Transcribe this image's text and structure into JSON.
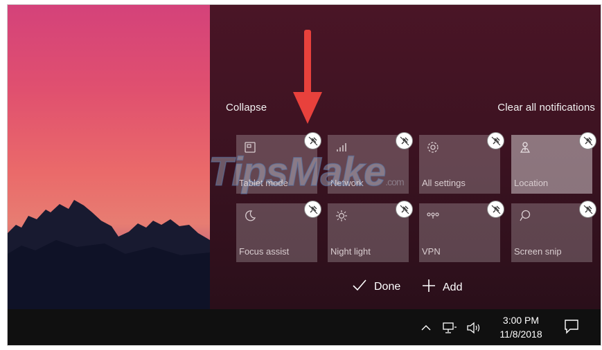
{
  "action_center": {
    "collapse_label": "Collapse",
    "clear_all_label": "Clear all notifications",
    "tiles": [
      {
        "label": "Tablet mode",
        "icon": "tablet-mode-icon",
        "selected": false
      },
      {
        "label": "Network",
        "icon": "network-icon",
        "selected": false
      },
      {
        "label": "All settings",
        "icon": "settings-gear-icon",
        "selected": false
      },
      {
        "label": "Location",
        "icon": "location-icon",
        "selected": true
      },
      {
        "label": "Focus assist",
        "icon": "moon-icon",
        "selected": false
      },
      {
        "label": "Night light",
        "icon": "brightness-icon",
        "selected": false
      },
      {
        "label": "VPN",
        "icon": "vpn-icon",
        "selected": false
      },
      {
        "label": "Screen snip",
        "icon": "screen-snip-icon",
        "selected": false
      }
    ],
    "done_label": "Done",
    "add_label": "Add"
  },
  "taskbar": {
    "time": "3:00 PM",
    "date": "11/8/2018",
    "tray_icons": [
      "chevron-up-icon",
      "network-icon",
      "volume-icon"
    ],
    "notification_icon": "action-center-icon"
  },
  "watermark": {
    "text": "TipsMake",
    "suffix": ".com"
  },
  "colors": {
    "annotation_arrow": "#e8413c",
    "action_center_bg": "#3e1322",
    "taskbar_bg": "#101010"
  }
}
